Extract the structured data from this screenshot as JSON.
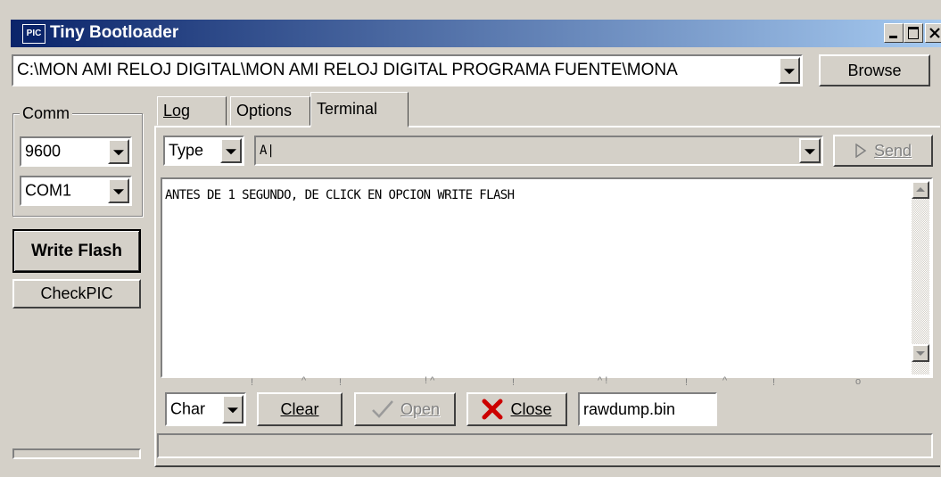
{
  "window": {
    "title": "Tiny Bootloader",
    "app_icon": "PIC",
    "controls": [
      "minimize",
      "maximize",
      "close"
    ]
  },
  "file": {
    "path": "C:\\MON AMI RELOJ DIGITAL\\MON AMI RELOJ DIGITAL PROGRAMA FUENTE\\MONA",
    "browse_label": "Browse"
  },
  "comm": {
    "group_label": "Comm",
    "baud": "9600",
    "port": "COM1"
  },
  "actions": {
    "write_flash": "Write Flash",
    "check_pic": "CheckPIC"
  },
  "tabs": [
    "Log",
    "Options",
    "Terminal"
  ],
  "terminal": {
    "type_value": "Type",
    "input_value": "A|",
    "send_label": "Send",
    "output": "ANTES DE 1 SEGUNDO, DE CLICK EN OPCION WRITE FLASH",
    "char_value": "Char",
    "clear_label": "Clear",
    "open_label": "Open",
    "close_label": "Close",
    "dump_file": "rawdump.bin"
  },
  "ruler_marks": [
    "!",
    "^",
    "!",
    "! ^",
    "!",
    "^ !",
    "!",
    "^",
    "!",
    "o"
  ]
}
